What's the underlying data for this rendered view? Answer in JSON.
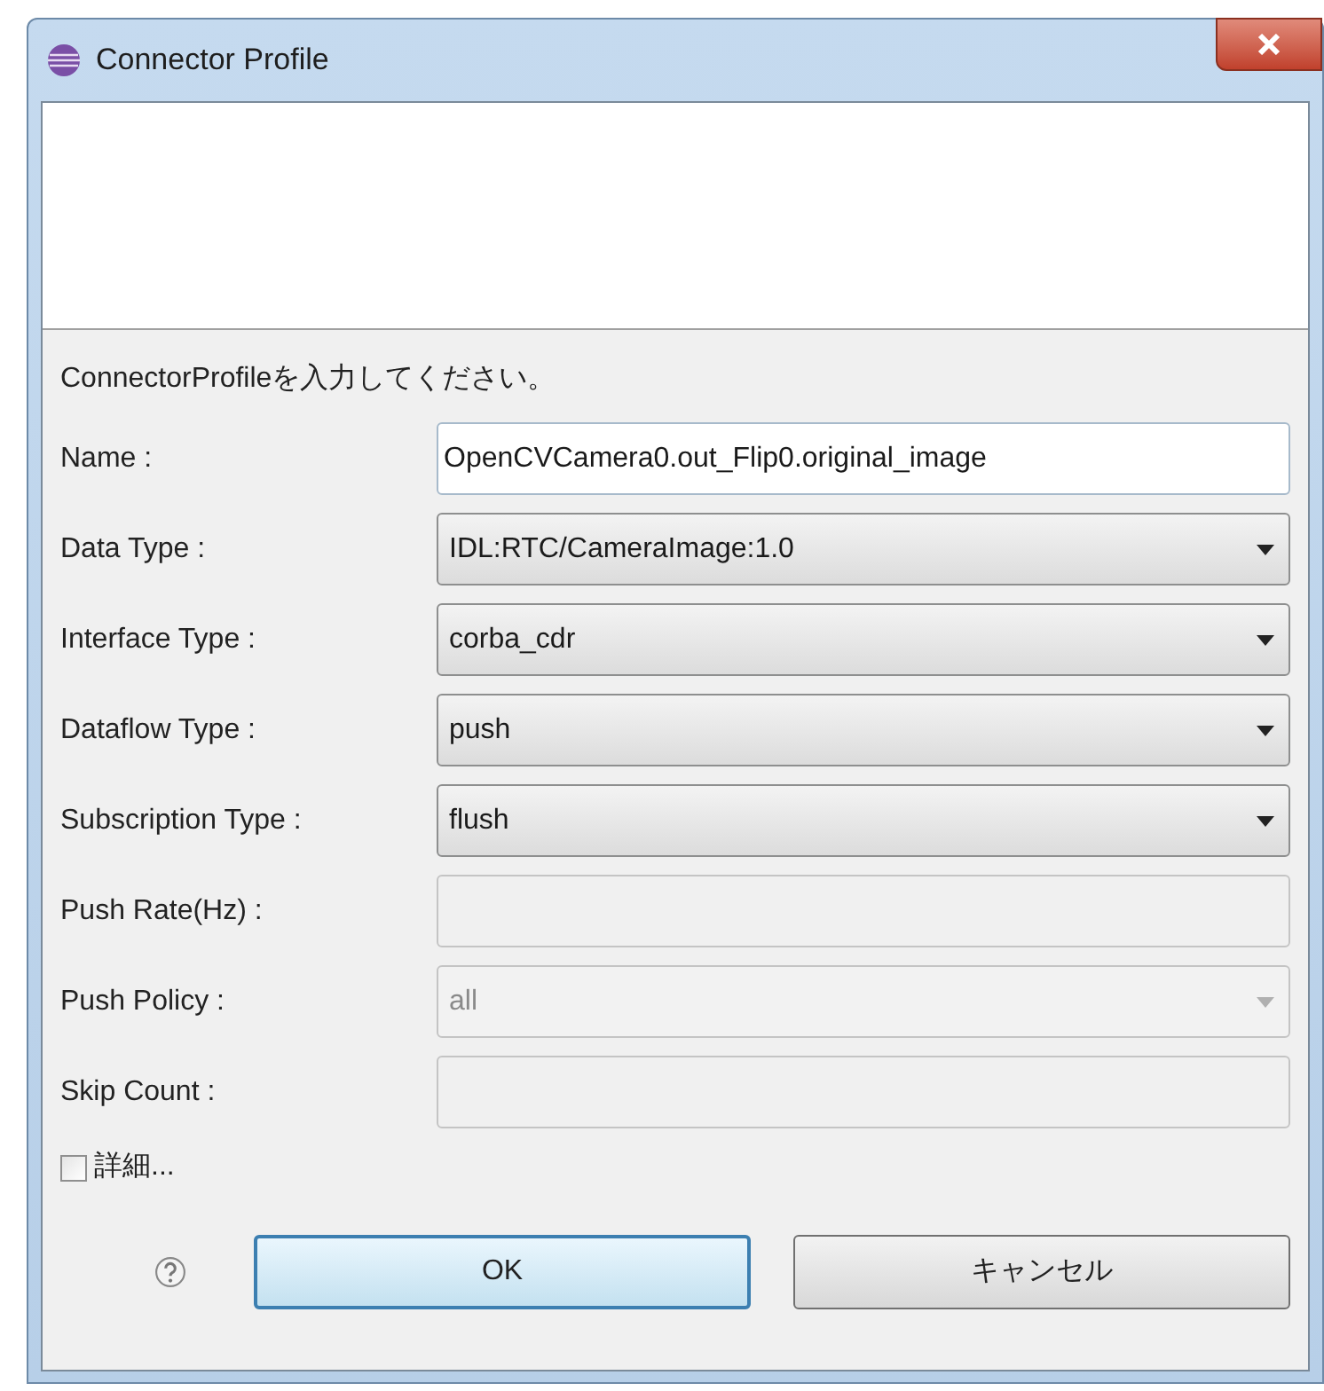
{
  "window": {
    "title": "Connector Profile"
  },
  "message": "ConnectorProfileを入力してください。",
  "fields": [
    {
      "label": "Name :",
      "kind": "text",
      "value": "OpenCVCamera0.out_Flip0.original_image",
      "disabled": false
    },
    {
      "label": "Data Type :",
      "kind": "combo",
      "value": "IDL:RTC/CameraImage:1.0",
      "disabled": false
    },
    {
      "label": "Interface Type :",
      "kind": "combo",
      "value": "corba_cdr",
      "disabled": false
    },
    {
      "label": "Dataflow Type :",
      "kind": "combo",
      "value": "push",
      "disabled": false
    },
    {
      "label": "Subscription Type :",
      "kind": "combo",
      "value": "flush",
      "disabled": false
    },
    {
      "label": "Push Rate(Hz) :",
      "kind": "text",
      "disabled": true
    },
    {
      "label": "Push Policy :",
      "kind": "combo",
      "value": "all",
      "disabled": true
    },
    {
      "label": "Skip Count :",
      "kind": "text",
      "disabled": true
    }
  ],
  "details": {
    "label": "詳細...",
    "checked": false
  },
  "buttons": [
    {
      "label": "OK",
      "default": true
    },
    {
      "label": "キャンセル",
      "default": false
    }
  ]
}
